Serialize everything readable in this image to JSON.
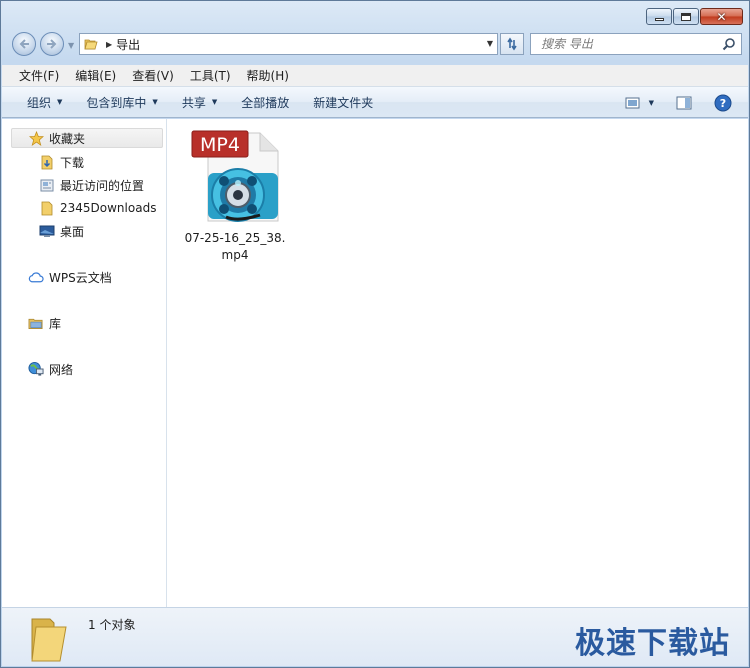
{
  "window": {
    "current_folder": "导出"
  },
  "search": {
    "placeholder": "搜索 导出"
  },
  "menu": [
    {
      "label": "文件(F)"
    },
    {
      "label": "编辑(E)"
    },
    {
      "label": "查看(V)"
    },
    {
      "label": "工具(T)"
    },
    {
      "label": "帮助(H)"
    }
  ],
  "toolbar": {
    "organize": "组织",
    "include_in_library": "包含到库中",
    "share": "共享",
    "play_all": "全部播放",
    "new_folder": "新建文件夹"
  },
  "sidebar": {
    "favorites": "收藏夹",
    "downloads": "下载",
    "recent": "最近访问的位置",
    "downloads2345": "2345Downloads",
    "desktop": "桌面",
    "wps": "WPS云文档",
    "library": "库",
    "network": "网络"
  },
  "files": [
    {
      "badge": "MP4",
      "name_line1": "07-25-16_25_38.",
      "name_line2": "mp4"
    }
  ],
  "status": {
    "count": "1 个对象"
  },
  "watermark": "极速下载站",
  "colors": {
    "accent": "#2a5a9f",
    "mp4_badge": "#b8302a",
    "reel": "#2aa0c8"
  }
}
